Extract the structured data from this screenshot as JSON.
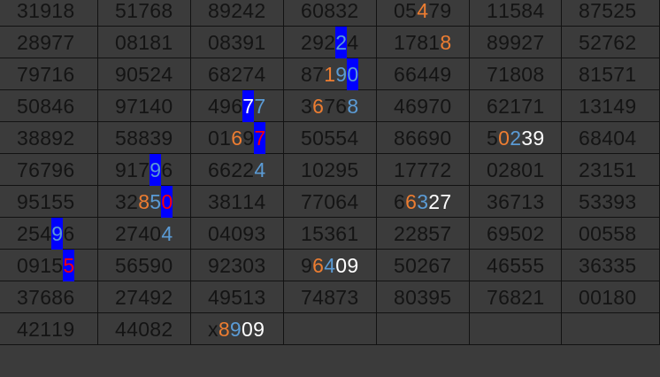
{
  "sheet": {
    "rows": [
      [
        "31918",
        "51768",
        "89242",
        "60832",
        "05479",
        "11584",
        "87525"
      ],
      [
        "28977",
        "08181",
        "08391",
        "29224",
        "17818",
        "89927",
        "52762"
      ],
      [
        "79716",
        "90524",
        "68274",
        "87190",
        "66449",
        "71808",
        "81571"
      ],
      [
        "50846",
        "97140",
        "49677",
        "36768",
        "46970",
        "62171",
        "13149"
      ],
      [
        "38892",
        "58839",
        "01697",
        "50554",
        "86690",
        "50239",
        "68404"
      ],
      [
        "76796",
        "91796",
        "66224",
        "10295",
        "17772",
        "02801",
        "23151"
      ],
      [
        "95155",
        "32850",
        "38114",
        "77064",
        "66327",
        "36713",
        "53393"
      ],
      [
        "25496",
        "27404",
        "04093",
        "15361",
        "22857",
        "69502",
        "00558"
      ],
      [
        "09155",
        "56590",
        "92303",
        "96409",
        "50267",
        "46555",
        "36335"
      ],
      [
        "37686",
        "27492",
        "49513",
        "74873",
        "80395",
        "76821",
        "00180"
      ],
      [
        "42119",
        "44082",
        "x8909",
        "",
        "",
        "",
        ""
      ]
    ],
    "highlights": [
      {
        "row": 0,
        "col": 4,
        "idx": 2,
        "style": "o"
      },
      {
        "row": 1,
        "col": 3,
        "idx": 3,
        "style": "hb"
      },
      {
        "row": 1,
        "col": 4,
        "idx": 4,
        "style": "o"
      },
      {
        "row": 2,
        "col": 3,
        "idx": 2,
        "style": "o"
      },
      {
        "row": 2,
        "col": 3,
        "idx": 3,
        "style": "lb"
      },
      {
        "row": 2,
        "col": 3,
        "idx": 4,
        "style": "hb"
      },
      {
        "row": 3,
        "col": 2,
        "idx": 3,
        "style": "hbw"
      },
      {
        "row": 3,
        "col": 2,
        "idx": 4,
        "style": "lb"
      },
      {
        "row": 3,
        "col": 3,
        "idx": 1,
        "style": "o"
      },
      {
        "row": 3,
        "col": 3,
        "idx": 4,
        "style": "lb"
      },
      {
        "row": 4,
        "col": 2,
        "idx": 2,
        "style": "o"
      },
      {
        "row": 4,
        "col": 2,
        "idx": 4,
        "style": "hbr"
      },
      {
        "row": 4,
        "col": 5,
        "idx": 1,
        "style": "o"
      },
      {
        "row": 4,
        "col": 5,
        "idx": 2,
        "style": "lb"
      },
      {
        "row": 4,
        "col": 5,
        "idx": 3,
        "style": "w"
      },
      {
        "row": 4,
        "col": 5,
        "idx": 4,
        "style": "w"
      },
      {
        "row": 5,
        "col": 1,
        "idx": 3,
        "style": "hb"
      },
      {
        "row": 5,
        "col": 2,
        "idx": 4,
        "style": "lb"
      },
      {
        "row": 6,
        "col": 1,
        "idx": 2,
        "style": "o"
      },
      {
        "row": 6,
        "col": 1,
        "idx": 3,
        "style": "lb"
      },
      {
        "row": 6,
        "col": 1,
        "idx": 4,
        "style": "hbr"
      },
      {
        "row": 6,
        "col": 4,
        "idx": 1,
        "style": "o"
      },
      {
        "row": 6,
        "col": 4,
        "idx": 2,
        "style": "lb"
      },
      {
        "row": 6,
        "col": 4,
        "idx": 3,
        "style": "w"
      },
      {
        "row": 6,
        "col": 4,
        "idx": 4,
        "style": "w"
      },
      {
        "row": 7,
        "col": 0,
        "idx": 3,
        "style": "hb"
      },
      {
        "row": 7,
        "col": 1,
        "idx": 4,
        "style": "lb"
      },
      {
        "row": 8,
        "col": 0,
        "idx": 4,
        "style": "hbr"
      },
      {
        "row": 8,
        "col": 3,
        "idx": 1,
        "style": "o"
      },
      {
        "row": 8,
        "col": 3,
        "idx": 2,
        "style": "lb"
      },
      {
        "row": 8,
        "col": 3,
        "idx": 3,
        "style": "w"
      },
      {
        "row": 8,
        "col": 3,
        "idx": 4,
        "style": "w"
      },
      {
        "row": 10,
        "col": 2,
        "idx": 1,
        "style": "o"
      },
      {
        "row": 10,
        "col": 2,
        "idx": 2,
        "style": "lb"
      },
      {
        "row": 10,
        "col": 2,
        "idx": 3,
        "style": "w"
      },
      {
        "row": 10,
        "col": 2,
        "idx": 4,
        "style": "w"
      }
    ]
  }
}
